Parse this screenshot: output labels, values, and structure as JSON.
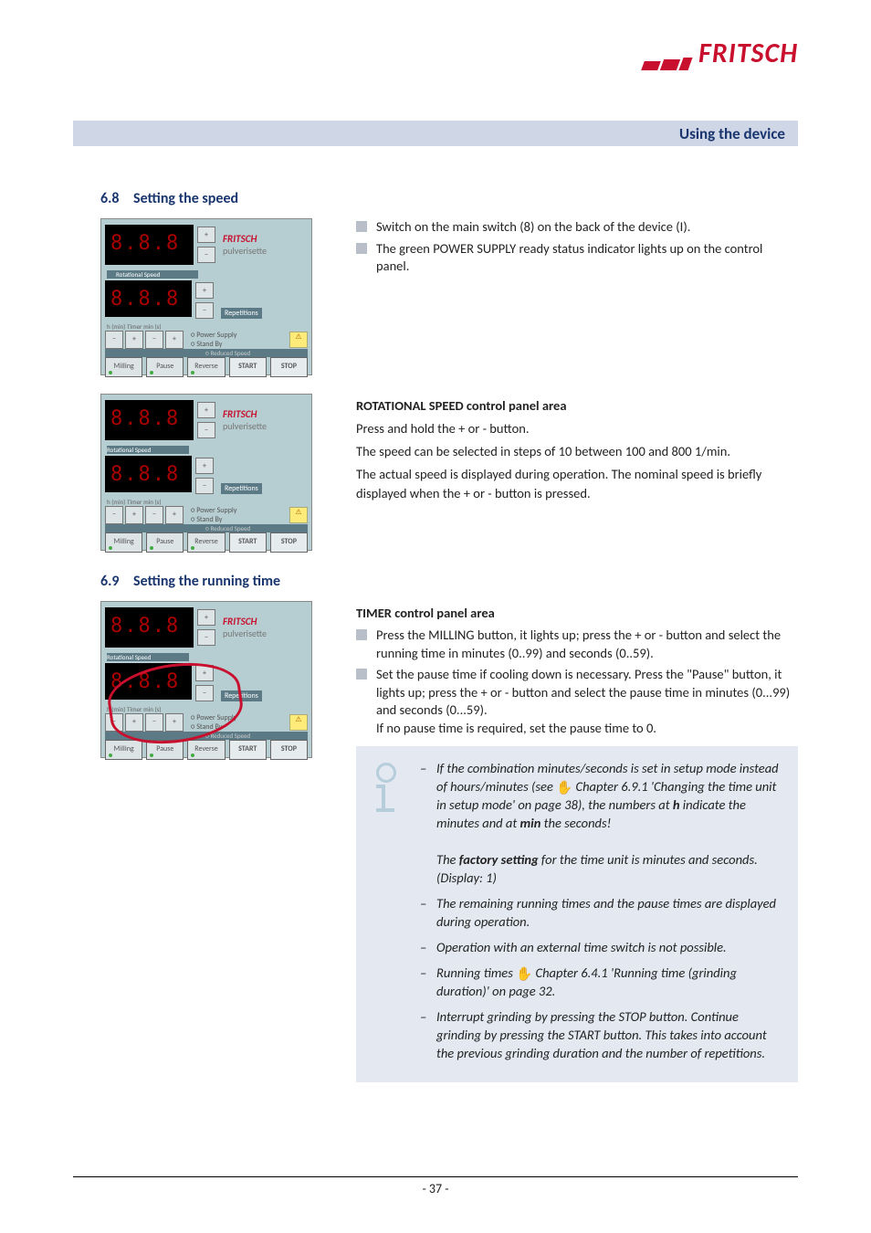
{
  "logo_text": "FRITSCH",
  "page_title": "Using the device",
  "section68": {
    "num": "6.8",
    "title": "Setting the speed",
    "bullets": [
      "Switch on the main switch (8) on the back of the device (I).",
      "The green POWER SUPPLY ready status indicator lights up on the control panel."
    ],
    "sub_heading": "ROTATIONAL SPEED control panel area",
    "paras": [
      "Press and hold the + or - button.",
      "The speed can be selected in steps of 10 between 100 and 800 1/min.",
      "The actual speed is displayed during operation. The nominal speed is briefly displayed when the + or - button is pressed."
    ]
  },
  "section69": {
    "num": "6.9",
    "title": "Setting the running time",
    "sub_heading": "TIMER control panel area",
    "bullets": [
      "Press the MILLING button, it lights up; press the + or - button and select the running time in minutes (0..99) and seconds (0..59).",
      "Set the pause time if cooling down is necessary. Press the \"Pause\" button, it lights up; press the + or - button and select the pause time in minutes (0...99) and seconds (0...59)."
    ],
    "no_pause": "If no pause time is required, set the pause time to 0.",
    "info": {
      "i1_a": "If the combination minutes/seconds is set in setup mode instead of hours/minutes (see ",
      "i1_link": "Chapter 6.9.1 'Changing the time unit in setup mode' on page 38",
      "i1_b": "), the numbers at ",
      "i1_h": "h",
      "i1_c": " indicate the minutes and at ",
      "i1_min": "min",
      "i1_d": " the seconds!",
      "i1_factory_a": "The ",
      "i1_factory_b": "factory setting",
      "i1_factory_c": " for the time unit is minutes and seconds. (Display: 1)",
      "i2": "The remaining running times and the pause times are displayed during operation.",
      "i3": "Operation with an external time switch is not possible.",
      "i4_a": "Running times ",
      "i4_link": "Chapter 6.4.1 'Running time (grinding duration)' on page 32",
      "i4_b": ".",
      "i5": "Interrupt grinding by pressing the STOP button. Continue grinding by pressing the START button. This takes into account the previous grinding duration and the number of repetitions."
    }
  },
  "panel": {
    "brand_top": "FRITSCH",
    "brand_sub": "pulverisette",
    "rot_label": "Rotational  Speed",
    "rep_label": "Repetitions",
    "row_labels": "h (min)     Timer     min (s)",
    "status1": "Power Supply",
    "status2": "Stand By",
    "status3": "Reduced Speed",
    "btn_mill": "Milling",
    "btn_pause": "Pause",
    "btn_rev": "Reverse",
    "btn_start": "START",
    "btn_stop": "STOP"
  },
  "page_number": "- 37 -"
}
